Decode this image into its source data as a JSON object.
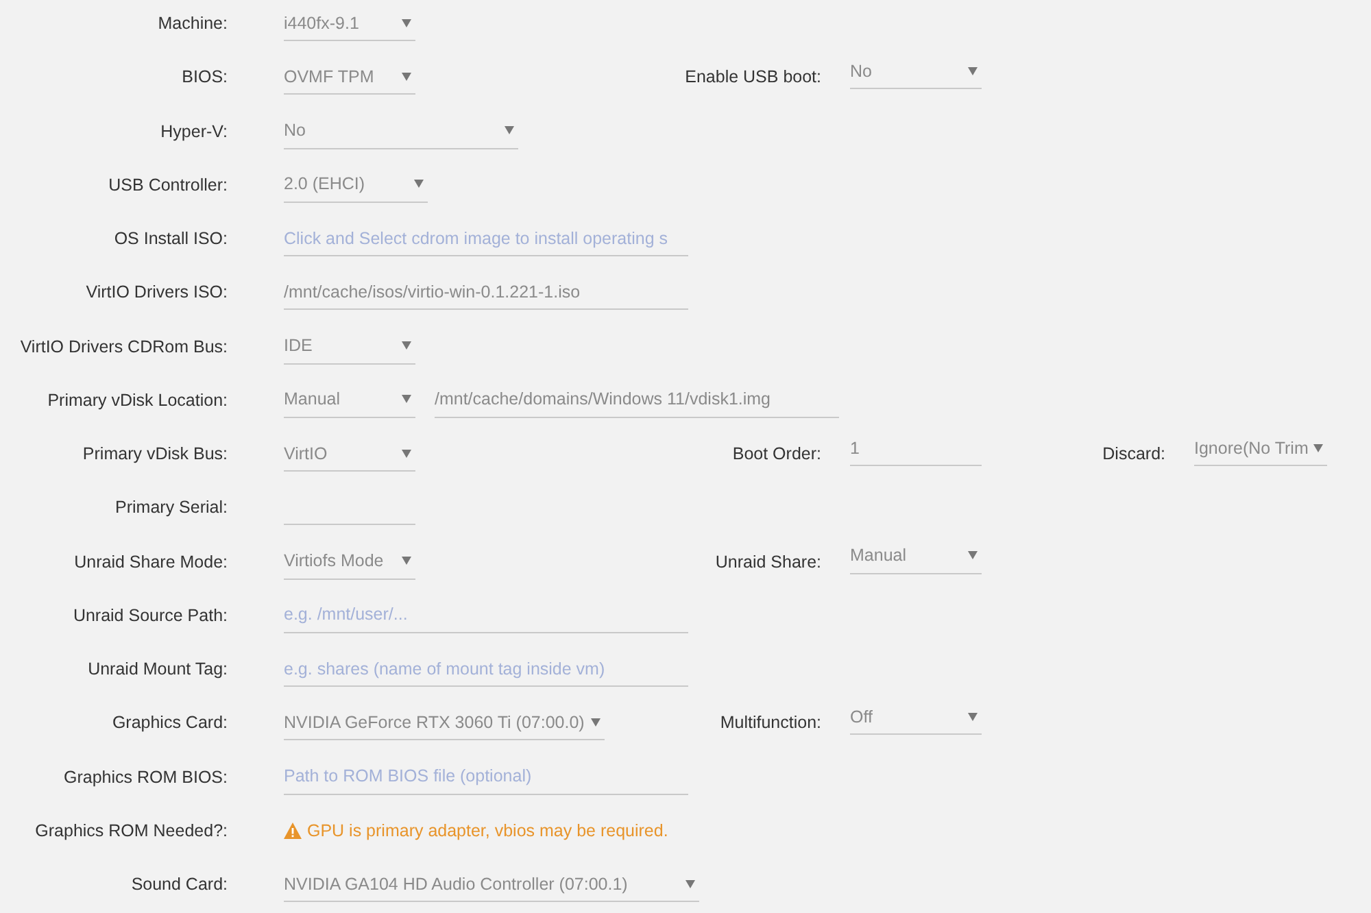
{
  "rows": [
    {
      "label": "Machine:",
      "fields": [
        {
          "kind": "select",
          "value": "i440fx-9.1"
        }
      ]
    },
    {
      "label": "BIOS:",
      "fields": [
        {
          "kind": "select",
          "value": "OVMF TPM"
        }
      ],
      "side": [
        {
          "label": "Enable USB boot:",
          "field": {
            "kind": "select",
            "value": "No"
          }
        }
      ]
    },
    {
      "label": "Hyper-V:",
      "fields": [
        {
          "kind": "select",
          "value": "No"
        }
      ]
    },
    {
      "label": "USB Controller:",
      "fields": [
        {
          "kind": "select",
          "value": "2.0 (EHCI)"
        }
      ]
    },
    {
      "label": "OS Install ISO:",
      "fields": [
        {
          "kind": "input",
          "placeholder": "Click and Select cdrom image to install operating s"
        }
      ]
    },
    {
      "label": "VirtIO Drivers ISO:",
      "fields": [
        {
          "kind": "input",
          "value": "/mnt/cache/isos/virtio-win-0.1.221-1.iso"
        }
      ]
    },
    {
      "label": "VirtIO Drivers CDRom Bus:",
      "fields": [
        {
          "kind": "select",
          "value": "IDE"
        }
      ]
    },
    {
      "label": "Primary vDisk Location:",
      "fields": [
        {
          "kind": "select",
          "value": "Manual"
        },
        {
          "kind": "input",
          "value": "/mnt/cache/domains/Windows 11/vdisk1.img"
        }
      ]
    },
    {
      "label": "Primary vDisk Bus:",
      "fields": [
        {
          "kind": "select",
          "value": "VirtIO"
        }
      ],
      "side": [
        {
          "label": "Boot Order:",
          "field": {
            "kind": "input",
            "value": "1"
          }
        },
        {
          "label": "Discard:",
          "field": {
            "kind": "select",
            "value": "Ignore(No Trim"
          }
        }
      ]
    },
    {
      "label": "Primary Serial:",
      "fields": [
        {
          "kind": "input"
        }
      ]
    },
    {
      "label": "Unraid Share Mode:",
      "fields": [
        {
          "kind": "select",
          "value": "Virtiofs Mode"
        }
      ],
      "side": [
        {
          "label": "Unraid Share:",
          "field": {
            "kind": "select",
            "value": "Manual"
          }
        }
      ]
    },
    {
      "label": "Unraid Source Path:",
      "fields": [
        {
          "kind": "input",
          "placeholder": "e.g. /mnt/user/..."
        }
      ]
    },
    {
      "label": "Unraid Mount Tag:",
      "fields": [
        {
          "kind": "input",
          "placeholder": "e.g. shares (name of mount tag inside vm)"
        }
      ]
    },
    {
      "label": "Graphics Card:",
      "fields": [
        {
          "kind": "select",
          "value": "NVIDIA GeForce RTX 3060 Ti (07:00.0)"
        }
      ],
      "side": [
        {
          "label": "Multifunction:",
          "field": {
            "kind": "select",
            "value": "Off"
          }
        }
      ]
    },
    {
      "label": "Graphics ROM BIOS:",
      "fields": [
        {
          "kind": "input",
          "placeholder": "Path to ROM BIOS file (optional)"
        }
      ]
    },
    {
      "label": "Graphics ROM Needed?:",
      "fields": [
        {
          "kind": "warning",
          "text": "GPU is primary adapter, vbios may be required."
        }
      ]
    },
    {
      "label": "Sound Card:",
      "fields": [
        {
          "kind": "select",
          "value": "NVIDIA GA104 HD Audio Controller (07:00.1)"
        }
      ]
    }
  ]
}
